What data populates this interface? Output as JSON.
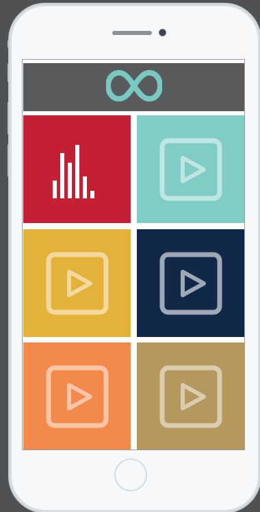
{
  "app": {
    "logo_icon": "infinity-icon",
    "header_color": "#585a5c",
    "logo_color": "#79c9c2"
  },
  "tiles": [
    {
      "icon": "bar-chart-icon",
      "color": "#c51f33"
    },
    {
      "icon": "play-icon",
      "color": "#80cdc6"
    },
    {
      "icon": "play-icon",
      "color": "#e4b23b"
    },
    {
      "icon": "play-icon",
      "color": "#112849"
    },
    {
      "icon": "play-icon",
      "color": "#f4894d"
    },
    {
      "icon": "play-icon",
      "color": "#b4985e"
    }
  ]
}
